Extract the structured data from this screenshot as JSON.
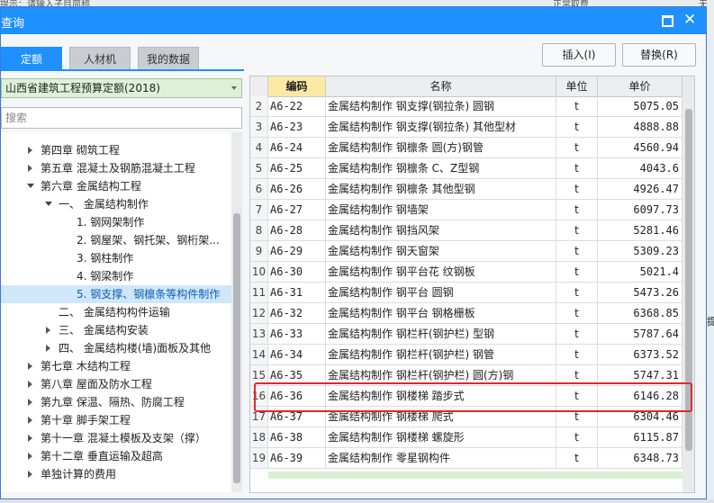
{
  "background": {
    "top_text_left": "提示：请输入子目简称",
    "top_text_mid": "正常取费",
    "right_fragment_1": "无",
    "right_fragment_2": "提"
  },
  "window": {
    "title": "查询",
    "max_icon": "maximize-icon",
    "close_icon": "close-icon",
    "close_glyph": "✕"
  },
  "tabs": [
    {
      "label": "定额"
    },
    {
      "label": "人材机"
    },
    {
      "label": "我的数据"
    }
  ],
  "buttons": {
    "insert": "插入(I)",
    "replace": "替换(R)"
  },
  "left": {
    "quota_library": "山西省建筑工程预算定额(2018)",
    "search_placeholder": "搜索",
    "tree": [
      {
        "label": "第四章 砌筑工程"
      },
      {
        "label": "第五章 混凝土及钢筋混凝土工程"
      },
      {
        "label": "第六章 金属结构工程"
      },
      {
        "label": "一、 金属结构制作"
      },
      {
        "label": "1. 钢网架制作"
      },
      {
        "label": "2. 钢屋架、钢托架、钢桁架..."
      },
      {
        "label": "3. 钢柱制作"
      },
      {
        "label": "4. 钢梁制作"
      },
      {
        "label": "5. 钢支撑、钢檩条等构件制作"
      },
      {
        "label": "二、 金属结构构件运输"
      },
      {
        "label": "三、 金属结构安装"
      },
      {
        "label": "四、 金属结构楼(墙)面板及其他"
      },
      {
        "label": "第七章 木结构工程"
      },
      {
        "label": "第八章 屋面及防水工程"
      },
      {
        "label": "第九章 保温、隔热、防腐工程"
      },
      {
        "label": "第十章 脚手架工程"
      },
      {
        "label": "第十一章 混凝土模板及支架（撑）"
      },
      {
        "label": "第十二章 垂直运输及超高"
      },
      {
        "label": "单独计算的费用"
      }
    ]
  },
  "grid": {
    "headers": {
      "code": "编码",
      "name": "名称",
      "unit": "单位",
      "price": "单价"
    },
    "rows": [
      {
        "idx": "2",
        "code": "A6-22",
        "name": "金属结构制作 钢支撑(钢拉条) 圆钢",
        "unit": "t",
        "price": "5075.05"
      },
      {
        "idx": "3",
        "code": "A6-23",
        "name": "金属结构制作 钢支撑(钢拉条) 其他型材",
        "unit": "t",
        "price": "4888.88"
      },
      {
        "idx": "4",
        "code": "A6-24",
        "name": "金属结构制作 钢檩条 圆(方)钢管",
        "unit": "t",
        "price": "4560.94"
      },
      {
        "idx": "5",
        "code": "A6-25",
        "name": "金属结构制作 钢檩条 C、Z型钢",
        "unit": "t",
        "price": "4043.6"
      },
      {
        "idx": "6",
        "code": "A6-26",
        "name": "金属结构制作 钢檩条 其他型钢",
        "unit": "t",
        "price": "4926.47"
      },
      {
        "idx": "7",
        "code": "A6-27",
        "name": "金属结构制作 钢墙架",
        "unit": "t",
        "price": "6097.73"
      },
      {
        "idx": "8",
        "code": "A6-28",
        "name": "金属结构制作 钢挡风架",
        "unit": "t",
        "price": "5281.46"
      },
      {
        "idx": "9",
        "code": "A6-29",
        "name": "金属结构制作 钢天窗架",
        "unit": "t",
        "price": "5309.23"
      },
      {
        "idx": "10",
        "code": "A6-30",
        "name": "金属结构制作 钢平台花 纹钢板",
        "unit": "t",
        "price": "5021.4"
      },
      {
        "idx": "11",
        "code": "A6-31",
        "name": "金属结构制作 钢平台 圆钢",
        "unit": "t",
        "price": "5473.26"
      },
      {
        "idx": "12",
        "code": "A6-32",
        "name": "金属结构制作 钢平台 钢格栅板",
        "unit": "t",
        "price": "6368.85"
      },
      {
        "idx": "13",
        "code": "A6-33",
        "name": "金属结构制作 钢栏杆(钢护栏) 型钢",
        "unit": "t",
        "price": "5787.64"
      },
      {
        "idx": "14",
        "code": "A6-34",
        "name": "金属结构制作 钢栏杆(钢护栏) 钢管",
        "unit": "t",
        "price": "6373.52"
      },
      {
        "idx": "15",
        "code": "A6-35",
        "name": "金属结构制作 钢栏杆(钢护栏) 圆(方)钢",
        "unit": "t",
        "price": "5747.31"
      },
      {
        "idx": "16",
        "code": "A6-36",
        "name": "金属结构制作 钢楼梯 踏步式",
        "unit": "t",
        "price": "6146.28"
      },
      {
        "idx": "17",
        "code": "A6-37",
        "name": "金属结构制作 钢楼梯 爬式",
        "unit": "t",
        "price": "6304.46"
      },
      {
        "idx": "18",
        "code": "A6-38",
        "name": "金属结构制作 钢楼梯 螺旋形",
        "unit": "t",
        "price": "6115.87"
      },
      {
        "idx": "19",
        "code": "A6-39",
        "name": "金属结构制作 零星钢构件",
        "unit": "t",
        "price": "6348.73"
      }
    ],
    "highlight_color": "#e0282e"
  }
}
